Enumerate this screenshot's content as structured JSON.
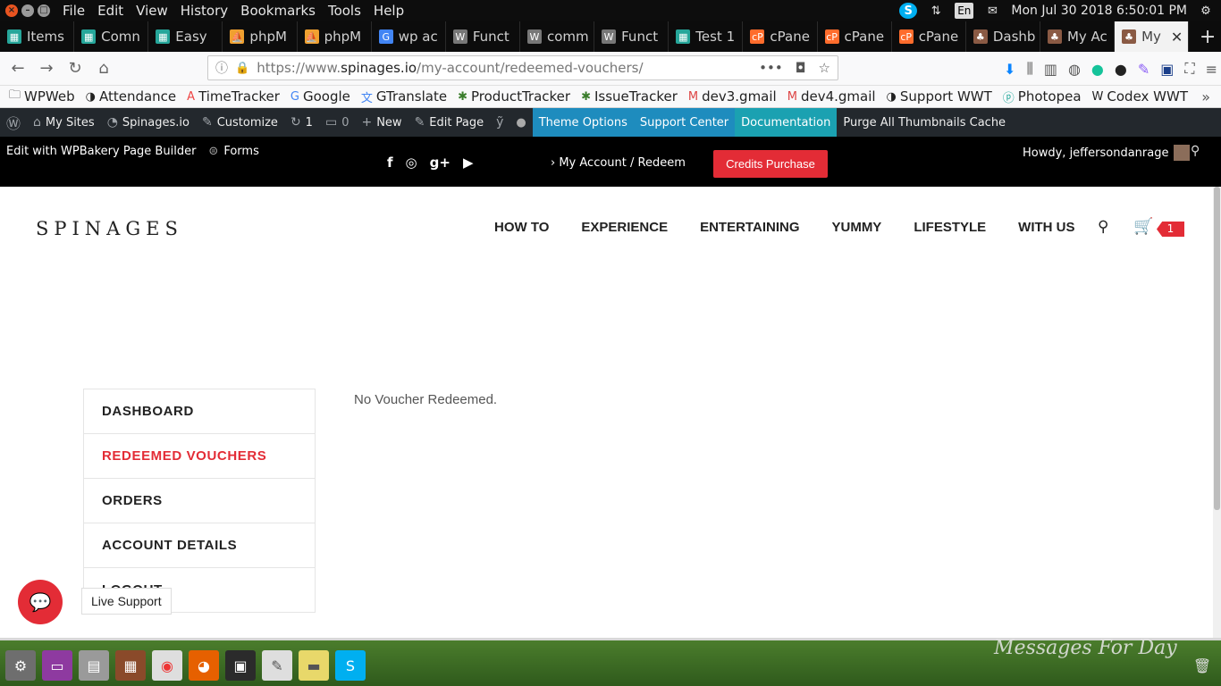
{
  "os": {
    "menus": [
      "File",
      "Edit",
      "View",
      "History",
      "Bookmarks",
      "Tools",
      "Help"
    ],
    "language": "En",
    "datetime": "Mon Jul 30 2018  6:50:01 PM"
  },
  "tabs": [
    {
      "label": "Items",
      "icon": "trello-icon",
      "color": "#26a69a"
    },
    {
      "label": "Comn",
      "icon": "trello-icon",
      "color": "#26a69a"
    },
    {
      "label": "Easy",
      "icon": "trello-icon",
      "color": "#26a69a"
    },
    {
      "label": "phpM",
      "icon": "phpmyadmin-icon",
      "color": "#f0a030"
    },
    {
      "label": "phpM",
      "icon": "phpmyadmin-icon",
      "color": "#f0a030"
    },
    {
      "label": "wp ac",
      "icon": "google-icon",
      "color": "#4285f4"
    },
    {
      "label": "Funct",
      "icon": "wordpress-icon",
      "color": "#777777"
    },
    {
      "label": "comm",
      "icon": "wordpress-icon",
      "color": "#777777"
    },
    {
      "label": "Funct",
      "icon": "wordpress-icon",
      "color": "#777777"
    },
    {
      "label": "Test 1",
      "icon": "trello-icon",
      "color": "#26a69a"
    },
    {
      "label": "cPane",
      "icon": "cpanel-icon",
      "color": "#ff6c2c"
    },
    {
      "label": "cPane",
      "icon": "cpanel-icon",
      "color": "#ff6c2c"
    },
    {
      "label": "cPane",
      "icon": "cpanel-icon",
      "color": "#ff6c2c"
    },
    {
      "label": "Dashb",
      "icon": "tree-icon",
      "color": "#8a5a44"
    },
    {
      "label": "My Ac",
      "icon": "tree-icon",
      "color": "#8a5a44"
    },
    {
      "label": "My",
      "icon": "tree-icon",
      "color": "#8a5a44",
      "active": true
    }
  ],
  "url": {
    "scheme": "https://www.",
    "domain": "spinages.io",
    "path": "/my-account/redeemed-vouchers/"
  },
  "bookmarks": [
    "WPWeb",
    "Attendance",
    "TimeTracker",
    "Google",
    "GTranslate",
    "ProductTracker",
    "IssueTracker",
    "dev3.gmail",
    "dev4.gmail",
    "Support WWT",
    "Photopea",
    "Codex WWT"
  ],
  "wpbar": {
    "my_sites": "My Sites",
    "site": "Spinages.io",
    "customize": "Customize",
    "updates": "1",
    "comments": "0",
    "new": "New",
    "edit_page": "Edit Page",
    "theme_options": "Theme Options",
    "support_center": "Support Center",
    "documentation": "Documentation",
    "purge": "Purge All Thumbnails Cache"
  },
  "sitebar": {
    "wpbakery": "Edit with WPBakery Page Builder",
    "forms": "Forms",
    "breadcrumb": "My Account / Redeem",
    "credits_button": "Credits Purchase",
    "howdy": "Howdy, jeffersondanrage"
  },
  "header": {
    "logo": "SPINAGES",
    "nav": [
      "HOW TO",
      "EXPERIENCE",
      "ENTERTAINING",
      "YUMMY",
      "LIFESTYLE",
      "WITH US"
    ],
    "cart_count": "1"
  },
  "account": {
    "menu": [
      "DASHBOARD",
      "REDEEMED VOUCHERS",
      "ORDERS",
      "ACCOUNT DETAILS",
      "LOGOUT"
    ],
    "active_index": 1,
    "message": "No Voucher Redeemed."
  },
  "chat": {
    "label": "Live Support"
  },
  "desktop": {
    "wallpaper_text": "Messages For Day"
  },
  "colors": {
    "accent": "#e32c36",
    "wp_bar": "#23282d",
    "theme_options": "#1e8cbe",
    "documentation": "#1ba1b1"
  }
}
